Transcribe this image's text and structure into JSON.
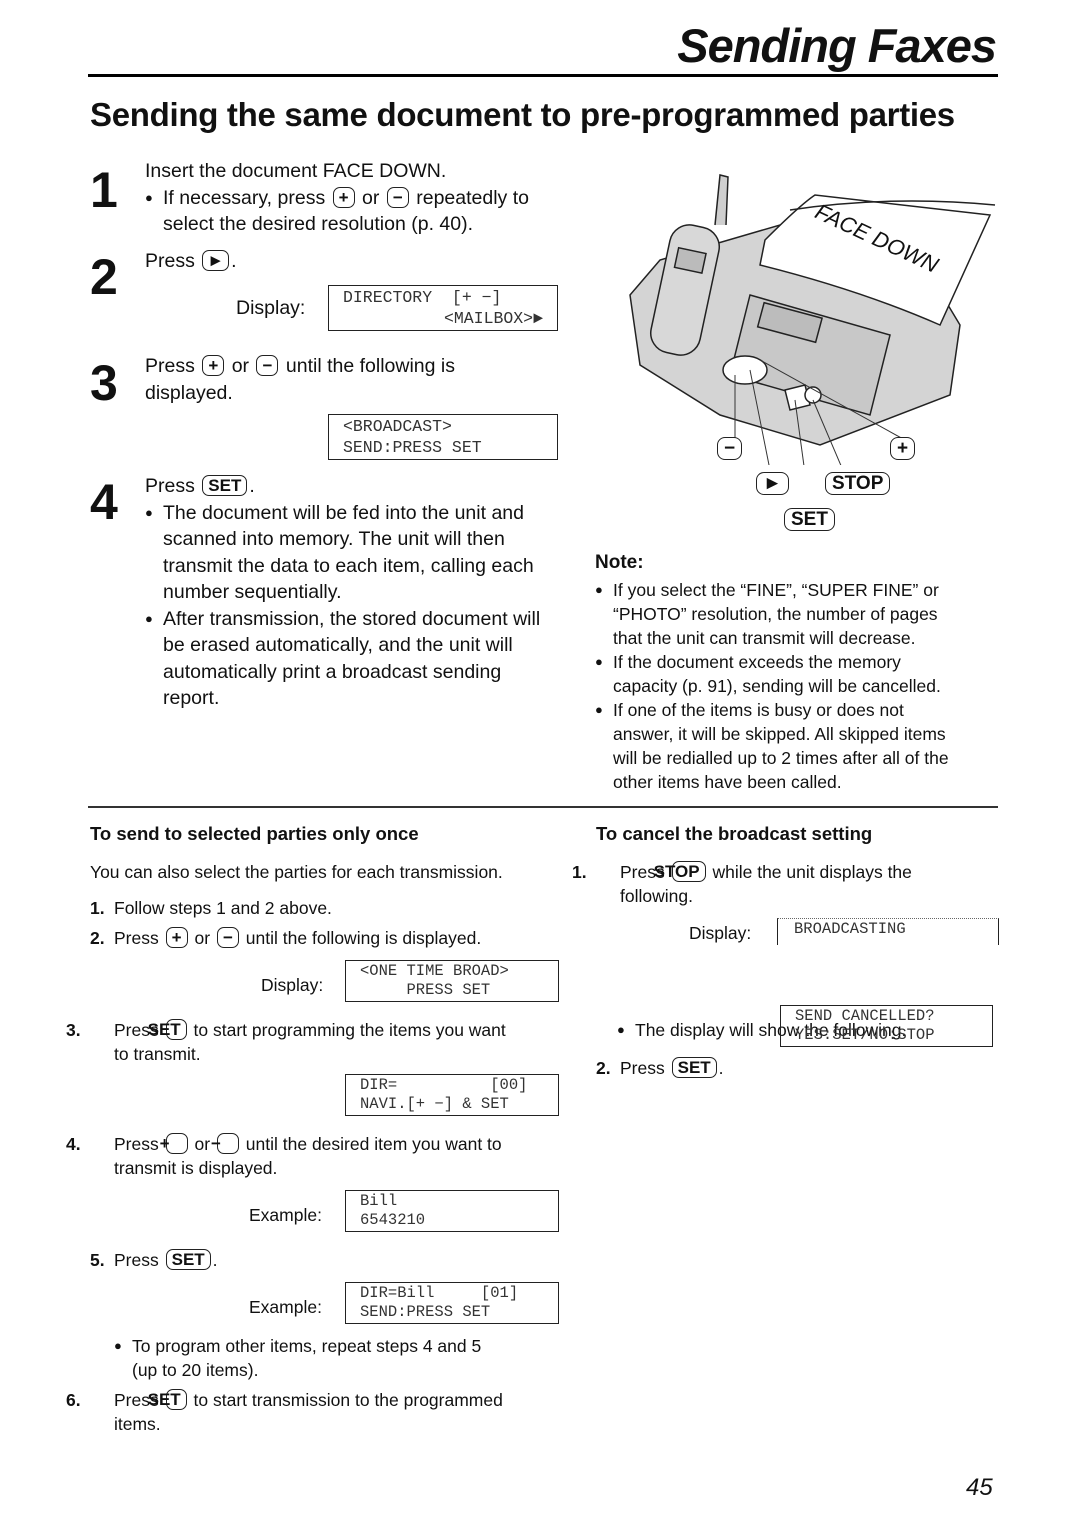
{
  "header": {
    "title": "Sending Faxes"
  },
  "section_title": "Sending the same document to pre-programmed parties",
  "steps": [
    {
      "num": "1",
      "text": "Insert the document FACE DOWN.",
      "bullet_pre": "If necessary, press",
      "key_plus": "+",
      "or": "or",
      "key_minus": "−",
      "bullet_post": "repeatedly to",
      "bullet_line2": "select the desired resolution (p. 40)."
    },
    {
      "num": "2",
      "press": "Press",
      "key": "►",
      "period": ".",
      "display_label": "Display:",
      "lcd_line1": "DIRECTORY  [+ −]",
      "lcd_line2": "<MAILBOX>►"
    },
    {
      "num": "3",
      "press": "Press",
      "key_plus": "+",
      "or": "or",
      "key_minus": "−",
      "post": "until the following is",
      "line2": "displayed.",
      "lcd_line1": "<BROADCAST>",
      "lcd_line2": "SEND:PRESS SET"
    },
    {
      "num": "4",
      "press": "Press",
      "key": "SET",
      "period": ".",
      "bullets": [
        [
          "The document will be fed into the unit and",
          "scanned into memory. The unit will then",
          "transmit the data to each item, calling each",
          "number sequentially."
        ],
        [
          "After transmission, the stored document will",
          "be erased automatically, and the unit will",
          "automatically print a broadcast sending",
          "report."
        ]
      ]
    }
  ],
  "illustration": {
    "paper_text": "FACE DOWN",
    "callouts": {
      "minus": "−",
      "plus": "+",
      "play": "►",
      "stop": "STOP",
      "set": "SET"
    }
  },
  "note": {
    "title": "Note:",
    "items": [
      [
        "If you select the “FINE”, “SUPER FINE” or",
        "“PHOTO” resolution, the number of pages",
        "that the unit can transmit will decrease."
      ],
      [
        "If the document exceeds the memory",
        "capacity (p. 91), sending will be cancelled."
      ],
      [
        "If one of the items is busy or does not",
        "answer, it will be skipped. All skipped items",
        "will be redialled up to 2 times after all of the",
        "other items have been called."
      ]
    ]
  },
  "once": {
    "title": "To send to selected parties only once",
    "intro": "You can also select the parties for each transmission.",
    "s1": {
      "n": "1.",
      "text": "Follow steps 1 and 2 above."
    },
    "s2": {
      "n": "2.",
      "press": "Press",
      "key_plus": "+",
      "or": "or",
      "key_minus": "−",
      "post": "until the following is displayed.",
      "display_label": "Display:",
      "lcd_line1": "<ONE TIME BROAD>",
      "lcd_line2": "     PRESS SET"
    },
    "s3": {
      "n": "3.",
      "press": "Press",
      "key": "SET",
      "post": "to start programming the items you want",
      "line2": "to transmit.",
      "lcd_line1": "DIR=          [00]",
      "lcd_line2": "NAVI.[+ −] & SET"
    },
    "s4": {
      "n": "4.",
      "press": "Press",
      "key_plus": "+",
      "or": "or",
      "key_minus": "−",
      "post": "until the desired item you want to",
      "line2": "transmit is displayed.",
      "example_label": "Example:",
      "lcd_line1": "Bill",
      "lcd_line2": "6543210"
    },
    "s5": {
      "n": "5.",
      "press": "Press",
      "key": "SET",
      "period": ".",
      "example_label": "Example:",
      "lcd_line1": "DIR=Bill     [01]",
      "lcd_line2": "SEND:PRESS SET"
    },
    "bullet": [
      "To program other items, repeat steps 4 and 5",
      "(up to 20 items)."
    ],
    "s6": {
      "n": "6.",
      "press": "Press",
      "key": "SET",
      "post": "to start transmission to the programmed",
      "line2": "items."
    }
  },
  "cancel": {
    "title": "To cancel the broadcast setting",
    "s1": {
      "n": "1.",
      "press": "Press",
      "key": "STOP",
      "post": "while the unit displays the",
      "line2": "following.",
      "display_label": "Display:",
      "lcd": "BROADCASTING"
    },
    "bullet": "The display will show the following.",
    "lcd2_line1": "SEND CANCELLED?",
    "lcd2_line2": "YES:SET/NO:STOP",
    "s2": {
      "n": "2.",
      "press": "Press",
      "key": "SET",
      "period": "."
    }
  },
  "page_number": "45"
}
